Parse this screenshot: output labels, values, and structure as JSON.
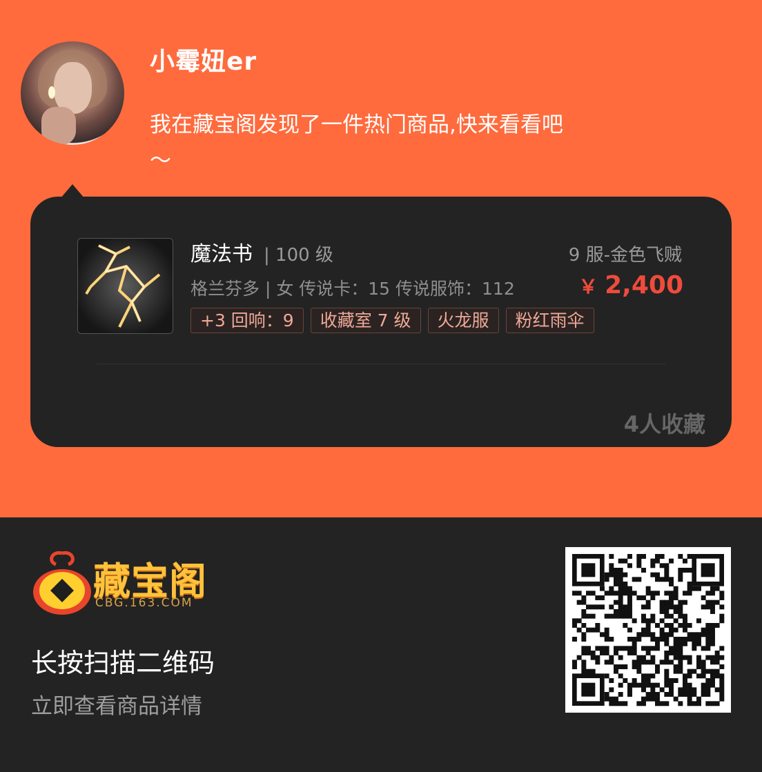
{
  "user": {
    "name": "小霉妞er",
    "message": "我在藏宝阁发现了一件热门商品,快来看看吧～"
  },
  "item": {
    "name": "魔法书",
    "level": "| 100 级",
    "server": "9 服-金色飞贼",
    "detail": "格兰芬多 | 女 传说卡：15 传说服饰：112",
    "price_currency": "￥",
    "price": "2,400",
    "tags": [
      "+3 回响：9",
      "收藏室 7 级",
      "火龙服",
      "粉红雨伞"
    ],
    "favorites": "4人收藏"
  },
  "footer": {
    "logo_text": "藏宝阁",
    "logo_sub": "CBG.163.COM",
    "qr_title": "长按扫描二维码",
    "qr_subtitle": "立即查看商品详情"
  },
  "colors": {
    "header_bg": "#ff6b3d",
    "card_bg": "#232323",
    "price": "#ef4b3c",
    "logo": "#ffc23b"
  },
  "icons": {
    "avatar": "user-avatar",
    "logo": "cbg-coin-logo",
    "qr": "qr-code"
  }
}
